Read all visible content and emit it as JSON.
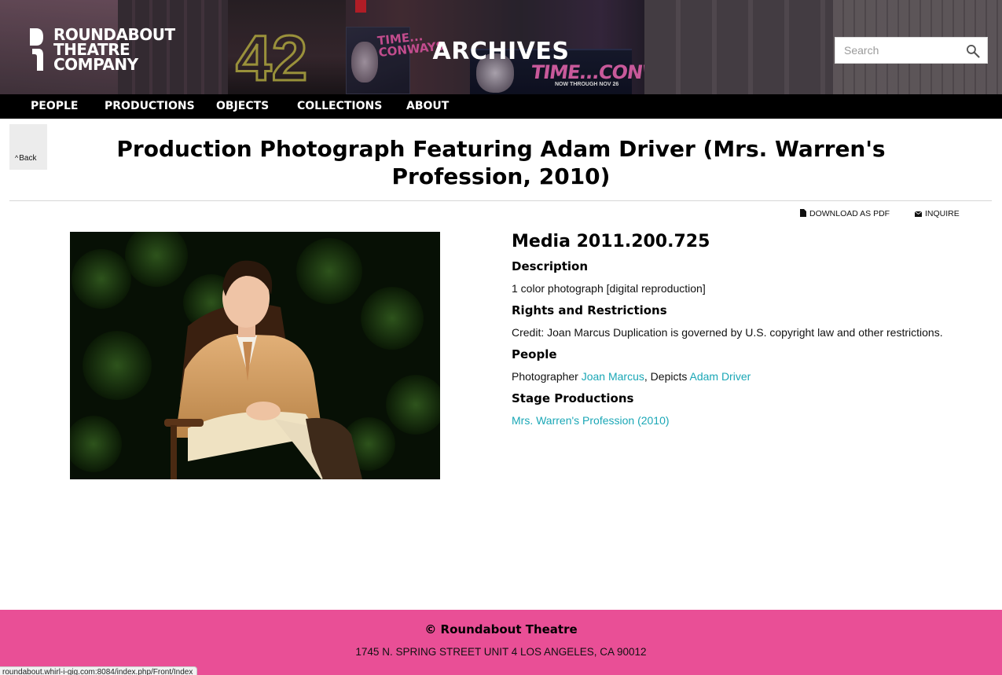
{
  "header": {
    "logo": {
      "line1": "ROUNDABOUT",
      "line2": "THEATRE",
      "line3": "COMPANY"
    },
    "title": "ARCHIVES",
    "search": {
      "placeholder": "Search",
      "value": ""
    },
    "backdrop_signs": {
      "marquee_text": "TIME...CONWAYS",
      "marquee_sub": "NOW THROUGH NOV 26",
      "poster_text": "TIME... CONWAYS",
      "street_number": "42"
    }
  },
  "nav": {
    "items": [
      {
        "label": "PEOPLE"
      },
      {
        "label": "PRODUCTIONS"
      },
      {
        "label": "OBJECTS"
      },
      {
        "label": "COLLECTIONS"
      },
      {
        "label": "ABOUT"
      }
    ]
  },
  "back": {
    "label": "Back"
  },
  "page": {
    "title": "Production Photograph Featuring Adam Driver (Mrs. Warren's Profession, 2010)"
  },
  "actions": {
    "download": "DOWNLOAD AS PDF",
    "inquire": "INQUIRE"
  },
  "record": {
    "media_id": "Media 2011.200.725",
    "description_heading": "Description",
    "description": "1 color photograph [digital reproduction]",
    "rights_heading": "Rights and Restrictions",
    "rights": "Credit: Joan Marcus Duplication is governed by U.S. copyright law and other restrictions.",
    "people_heading": "People",
    "people": {
      "role1": "Photographer",
      "person1": "Joan Marcus",
      "separator": ", Depicts",
      "person2": "Adam Driver"
    },
    "productions_heading": "Stage Productions",
    "production_link": "Mrs. Warren's Profession (2010)"
  },
  "footer": {
    "copyright": "© Roundabout Theatre",
    "address": "1745 N. SPRING STREET UNIT 4 LOS ANGELES, CA 90012"
  },
  "status_bar": {
    "url": "roundabout.whirl-i-gig.com:8084/index.php/Front/Index"
  },
  "colors": {
    "nav_bg": "#000000",
    "link": "#1aa7b6",
    "footer_bg": "#e94f96",
    "back_bg": "#ececec"
  }
}
